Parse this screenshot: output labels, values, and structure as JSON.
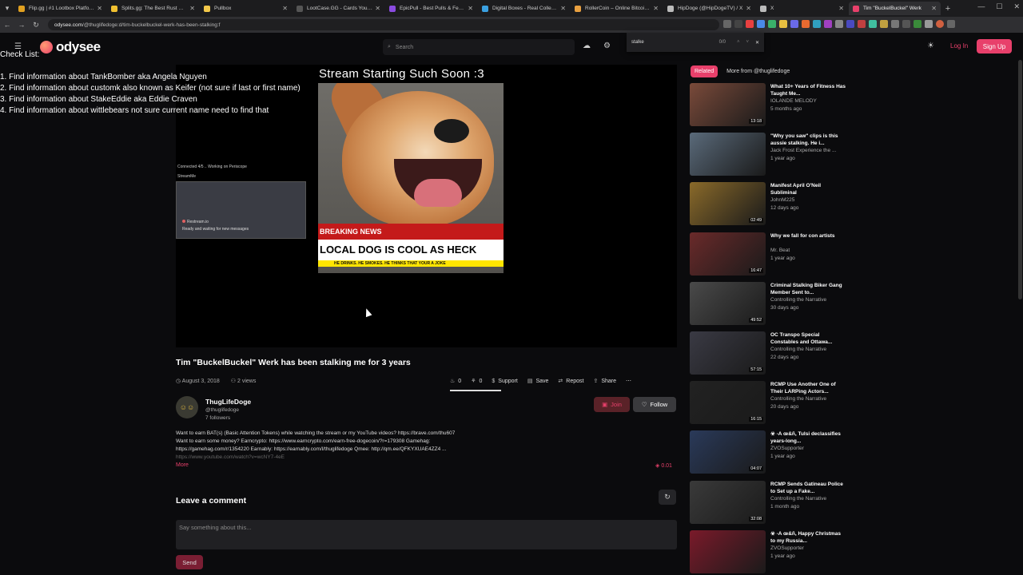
{
  "browser": {
    "tabs": [
      {
        "title": "Flip.gg | #1 Lootbox Platform",
        "color": "#e0a020"
      },
      {
        "title": "Splits.gg: The Best Rust Gamb...",
        "color": "#f0c030"
      },
      {
        "title": "Pullbox",
        "color": "#f3c84a"
      },
      {
        "title": "LootCase.GG - Cards You Love...",
        "color": "#555555"
      },
      {
        "title": "EpicPull - Best Pulls & Featur...",
        "color": "#8a4be0"
      },
      {
        "title": "Digital Boxes - Real Collectibl...",
        "color": "#3aa0e0"
      },
      {
        "title": "RollerCoin – Online Bitcoin Mi...",
        "color": "#e8a040"
      },
      {
        "title": "HipDoge (@HipDogeTV) / X",
        "color": "#bbbbbb"
      },
      {
        "title": "X",
        "color": "#bbbbbb"
      },
      {
        "title": "Tim \"BuckelBuckel\" Werk",
        "color": "#e8406b"
      }
    ],
    "url_host": "odysee.com",
    "url_path": "/@thuglifedoge:d/tim-buckelbuckel-werk-has-been-stalking:f"
  },
  "findbar": {
    "query": "stalke",
    "count": "0/0"
  },
  "header": {
    "brand": "odysee",
    "search_placeholder": "Search",
    "login": "Log In",
    "signup": "Sign Up"
  },
  "overlay": {
    "title": "Check List:",
    "items": [
      "1. Find information about TankBomber aka Angela Nguyen",
      "2. Find information about customk also known as Keifer (not sure if last or first name)",
      "3. Find information about StakeEddie aka Eddie Craven",
      "4. Find information about wittlebears not sure current name need to find that"
    ]
  },
  "player": {
    "stream_title": "Stream Starting Such Soon :3",
    "breaking": "BREAKING NEWS",
    "headline": "LOCAL DOG IS COOL AS HECK",
    "ticker": "HE DRINKS. HE SMOKES. HE THINKS THAT YOUR A JOKE",
    "chat_status_1": "Connected 4/5 .. Working on Periscope",
    "chat_status_2": "StreamMe",
    "chat_msg_1": "Restream.io",
    "chat_msg_2": "Ready and waiting for new messages"
  },
  "video": {
    "title": "Tim \"BuckelBuckel\" Werk has been stalking me for 3 years",
    "date": "August 3, 2018",
    "views": "2 views",
    "fire": "0",
    "slime": "0",
    "support": "Support",
    "save": "Save",
    "repost": "Repost",
    "share": "Share"
  },
  "channel": {
    "name": "ThugLifeDoge",
    "handle": "@thuglifedoge",
    "followers": "7 followers",
    "join": "Join",
    "follow": "Follow"
  },
  "description": {
    "line1": "Want to earn BAT(s) (Basic Attention Tokens) while watching the stream or my YouTube videos? https://brave.com/thu607",
    "line2": "Want to earn some money? Earncrypto: https://www.earncrypto.com/earn-free-dogecoin/?r=179308 Gamehag:",
    "line3": "https://gamehag.com/r/1354220 Earnably: https://earnably.com/l/thuglifedoge Qmee: http://qm.ee/QFKYXUAE4ZZ4 ...",
    "line4": "https://www.youtube.com/watch?v=wcNY7-4eE",
    "more": "More",
    "lbc": "0.01"
  },
  "comments": {
    "title": "Leave a comment",
    "placeholder": "Say something about this...",
    "send": "Send"
  },
  "related": {
    "tab_related": "Related",
    "tab_more": "More from @thuglifedoge",
    "items": [
      {
        "title": "What 10+ Years of Fitness Has Taught Me...",
        "channel": "IOLANDE MELODY",
        "date": "5 months ago",
        "duration": "13:18",
        "color": "#7a4a3a"
      },
      {
        "title": "\"Why you saw\" clips is this aussie stalking. He i...",
        "channel": "Jack Frost Experience the ...",
        "date": "1 year ago",
        "duration": "",
        "color": "#5a6a7a"
      },
      {
        "title": "Manifest April O'Neil Subliminal",
        "channel": "JohnM225",
        "date": "12 days ago",
        "duration": "02:49",
        "color": "#8a6a2a"
      },
      {
        "title": "Why we fall for con artists",
        "channel": "Mr. Beat",
        "date": "1 year ago",
        "duration": "16:47",
        "color": "#6a2a2a"
      },
      {
        "title": "Criminal Stalking Biker Gang Member Sent to...",
        "channel": "Controlling the Narrative",
        "date": "30 days ago",
        "duration": "49:52",
        "color": "#4a4a4a"
      },
      {
        "title": "OC Transpo Special Constables and Ottawa...",
        "channel": "Controlling the Narrative",
        "date": "22 days ago",
        "duration": "57:15",
        "color": "#3a3a44"
      },
      {
        "title": "RCMP Use Another One of Their LARPing Actors...",
        "channel": "Controlling the Narrative",
        "date": "20 days ago",
        "duration": "16:15",
        "color": "#222222"
      },
      {
        "title": "☣ -A œ&ñ, Tulsi declassifies years-long...",
        "channel": "ZVOSupporter",
        "date": "1 year ago",
        "duration": "04:07",
        "color": "#2a3a5a"
      },
      {
        "title": "RCMP Sends Gatineau Police to Set up a Fake...",
        "channel": "Controlling the Narrative",
        "date": "1 month ago",
        "duration": "32:08",
        "color": "#3a3a3a"
      },
      {
        "title": "☣ -A œ&ñ, Happy Christmas to my Russia...",
        "channel": "ZVOSupporter",
        "date": "1 year ago",
        "duration": "",
        "color": "#7a1a2a"
      }
    ]
  }
}
